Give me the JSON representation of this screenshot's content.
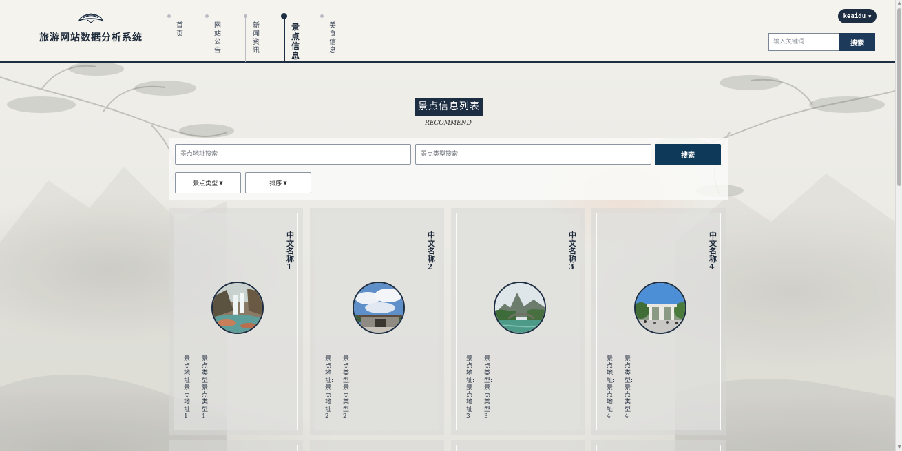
{
  "header": {
    "site_title": "旅游网站数据分析系统",
    "logo_icon": "fan-logo-icon",
    "nav": [
      {
        "label": "首页",
        "active": false
      },
      {
        "label": "网站公告",
        "active": false
      },
      {
        "label": "新闻资讯",
        "active": false
      },
      {
        "label": "景点信息",
        "active": true
      },
      {
        "label": "美食信息",
        "active": false
      }
    ],
    "user_label": "keaidu",
    "search_placeholder": "输入关键词",
    "search_button": "搜索"
  },
  "section": {
    "title": "景点信息列表",
    "subtitle": "RECOMMEND"
  },
  "filters": {
    "address_placeholder": "景点地址搜索",
    "type_placeholder": "景点类型搜索",
    "search_button": "搜索",
    "type_dropdown": "景点类型",
    "sort_dropdown": "排序"
  },
  "cards": [
    {
      "name": "中文名称1",
      "address": "景点地址:景点地址1",
      "type": "景点类型:景点类型1",
      "image": "waterfall"
    },
    {
      "name": "中文名称2",
      "address": "景点地址:景点地址2",
      "type": "景点类型:景点类型2",
      "image": "building-sky"
    },
    {
      "name": "中文名称3",
      "address": "景点地址:景点地址3",
      "type": "景点类型:景点类型3",
      "image": "karst-river"
    },
    {
      "name": "中文名称4",
      "address": "景点地址:景点地址4",
      "type": "景点类型:景点类型4",
      "image": "gate-plaza"
    }
  ],
  "colors": {
    "primary": "#1e2e42",
    "button": "#0f3958",
    "background": "#eceae4"
  }
}
